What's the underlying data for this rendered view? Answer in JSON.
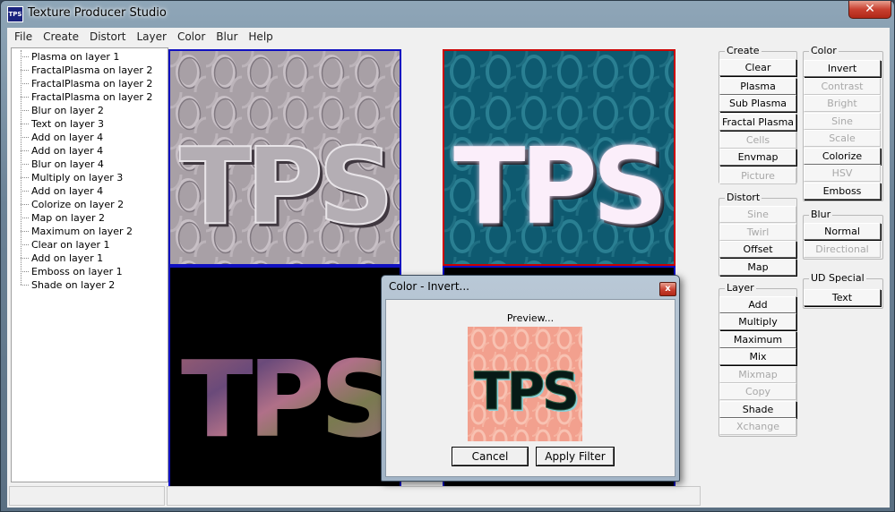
{
  "window": {
    "title": "Texture Producer Studio",
    "app_icon": "TPS",
    "close_glyph": "✕"
  },
  "menu": [
    "File",
    "Create",
    "Distort",
    "Layer",
    "Color",
    "Blur",
    "Help"
  ],
  "history": [
    "Plasma on layer 1",
    "FractalPlasma on layer 2",
    "FractalPlasma on layer 2",
    "FractalPlasma on layer 2",
    "Blur on layer 2",
    "Text on layer 3",
    "Add on layer 4",
    "Add on layer 4",
    "Blur on layer 4",
    "Multiply on layer 3",
    "Add on layer 4",
    "Colorize on layer 2",
    "Map on layer 2",
    "Maximum on layer 2",
    "Clear on layer 1",
    "Add on layer 1",
    "Emboss on layer 1",
    "Shade on layer 2"
  ],
  "tiles": {
    "text": "TPS"
  },
  "panels": {
    "create": {
      "title": "Create",
      "buttons": [
        "Clear",
        "Plasma",
        "Sub Plasma",
        "Fractal Plasma",
        "Cells",
        "Envmap",
        "Picture"
      ]
    },
    "distort": {
      "title": "Distort",
      "buttons": [
        "Sine",
        "Twirl",
        "Offset",
        "Map"
      ]
    },
    "layer": {
      "title": "Layer",
      "buttons": [
        "Add",
        "Multiply",
        "Maximum",
        "Mix",
        "Mixmap",
        "Copy",
        "Shade",
        "Xchange"
      ]
    },
    "color": {
      "title": "Color",
      "buttons": [
        "Invert",
        "Contrast",
        "Bright",
        "Sine",
        "Scale",
        "Colorize",
        "HSV",
        "Emboss"
      ]
    },
    "blur": {
      "title": "Blur",
      "buttons": [
        "Normal",
        "Directional"
      ]
    },
    "ud_special": {
      "title": "UD Special",
      "buttons": [
        "Text"
      ]
    }
  },
  "dialog": {
    "title": "Color - Invert...",
    "close_glyph": "x",
    "preview_label": "Preview...",
    "preview_text": "TPS",
    "cancel_label": "Cancel",
    "apply_label": "Apply Filter"
  },
  "colors": {
    "tile_border_selected": "#cc0000",
    "tile_border": "#1010c0",
    "teal": "#0e5a70",
    "preview_bg": "#f2a08e"
  }
}
